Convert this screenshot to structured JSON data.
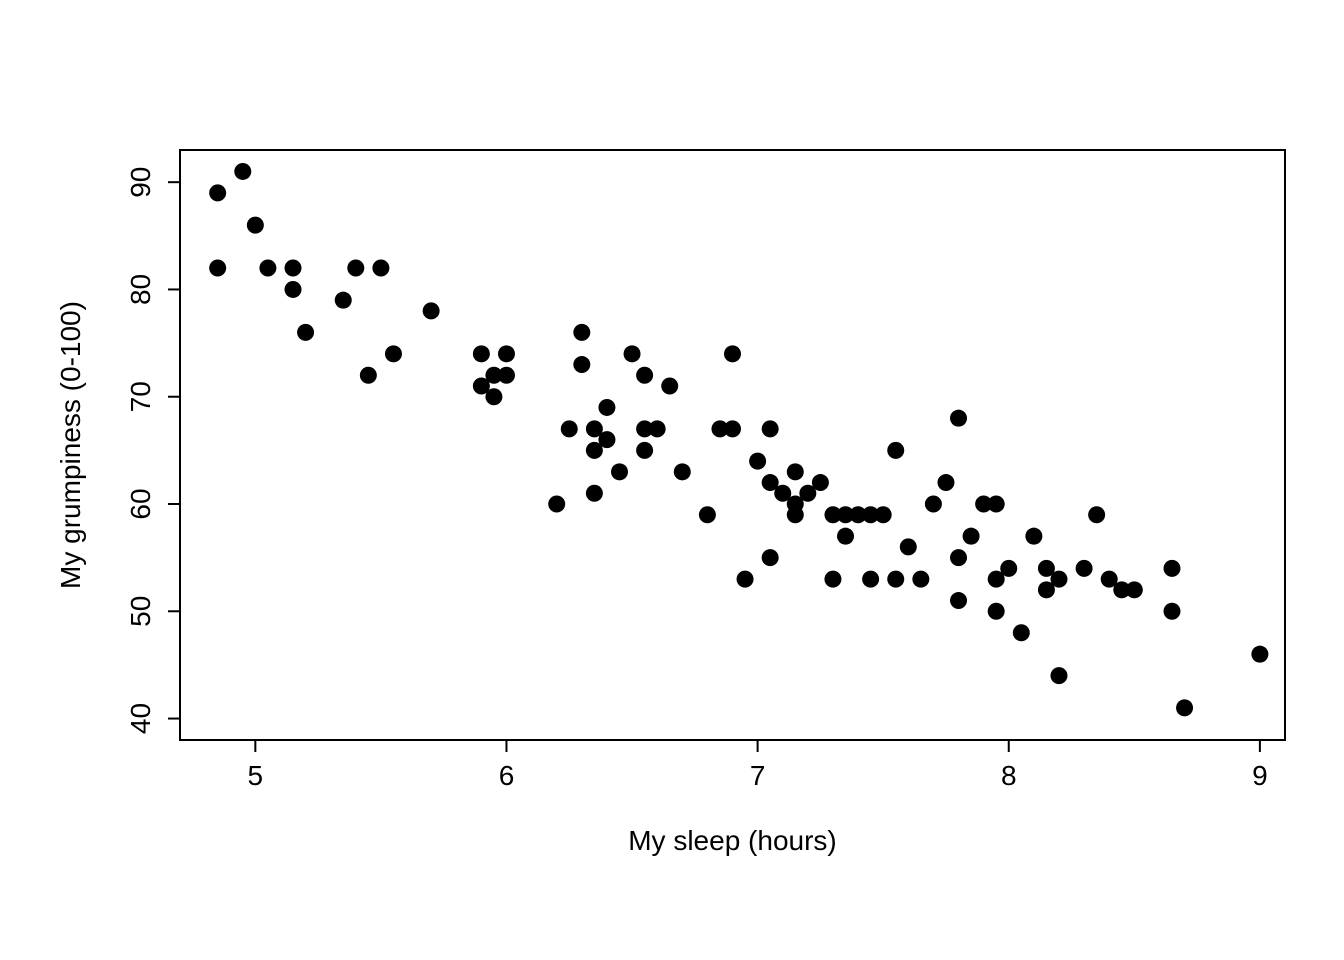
{
  "chart_data": {
    "type": "scatter",
    "title": "",
    "xlabel": "My sleep (hours)",
    "ylabel": "My grumpiness (0-100)",
    "xlim": [
      4.7,
      9.1
    ],
    "ylim": [
      38,
      93
    ],
    "xticks": [
      5,
      6,
      7,
      8,
      9
    ],
    "yticks": [
      40,
      50,
      60,
      70,
      80,
      90
    ],
    "series": [
      {
        "name": "grumpiness_vs_sleep",
        "points": [
          {
            "x": 4.85,
            "y": 89
          },
          {
            "x": 4.85,
            "y": 82
          },
          {
            "x": 4.95,
            "y": 91
          },
          {
            "x": 5.0,
            "y": 86
          },
          {
            "x": 5.05,
            "y": 82
          },
          {
            "x": 5.15,
            "y": 82
          },
          {
            "x": 5.15,
            "y": 80
          },
          {
            "x": 5.2,
            "y": 76
          },
          {
            "x": 5.35,
            "y": 79
          },
          {
            "x": 5.4,
            "y": 82
          },
          {
            "x": 5.45,
            "y": 72
          },
          {
            "x": 5.5,
            "y": 82
          },
          {
            "x": 5.55,
            "y": 74
          },
          {
            "x": 5.7,
            "y": 78
          },
          {
            "x": 5.9,
            "y": 71
          },
          {
            "x": 5.9,
            "y": 74
          },
          {
            "x": 5.95,
            "y": 70
          },
          {
            "x": 5.95,
            "y": 72
          },
          {
            "x": 6.0,
            "y": 74
          },
          {
            "x": 6.0,
            "y": 72
          },
          {
            "x": 6.2,
            "y": 60
          },
          {
            "x": 6.25,
            "y": 67
          },
          {
            "x": 6.3,
            "y": 73
          },
          {
            "x": 6.3,
            "y": 76
          },
          {
            "x": 6.35,
            "y": 65
          },
          {
            "x": 6.35,
            "y": 67
          },
          {
            "x": 6.35,
            "y": 61
          },
          {
            "x": 6.4,
            "y": 69
          },
          {
            "x": 6.4,
            "y": 66
          },
          {
            "x": 6.45,
            "y": 63
          },
          {
            "x": 6.5,
            "y": 74
          },
          {
            "x": 6.55,
            "y": 67
          },
          {
            "x": 6.55,
            "y": 72
          },
          {
            "x": 6.55,
            "y": 65
          },
          {
            "x": 6.6,
            "y": 67
          },
          {
            "x": 6.65,
            "y": 71
          },
          {
            "x": 6.7,
            "y": 63
          },
          {
            "x": 6.8,
            "y": 59
          },
          {
            "x": 6.85,
            "y": 67
          },
          {
            "x": 6.9,
            "y": 74
          },
          {
            "x": 6.9,
            "y": 67
          },
          {
            "x": 6.95,
            "y": 53
          },
          {
            "x": 7.0,
            "y": 64
          },
          {
            "x": 7.05,
            "y": 55
          },
          {
            "x": 7.05,
            "y": 67
          },
          {
            "x": 7.05,
            "y": 62
          },
          {
            "x": 7.1,
            "y": 61
          },
          {
            "x": 7.15,
            "y": 63
          },
          {
            "x": 7.15,
            "y": 60
          },
          {
            "x": 7.15,
            "y": 59
          },
          {
            "x": 7.2,
            "y": 61
          },
          {
            "x": 7.25,
            "y": 62
          },
          {
            "x": 7.3,
            "y": 59
          },
          {
            "x": 7.3,
            "y": 53
          },
          {
            "x": 7.35,
            "y": 57
          },
          {
            "x": 7.35,
            "y": 59
          },
          {
            "x": 7.4,
            "y": 59
          },
          {
            "x": 7.45,
            "y": 59
          },
          {
            "x": 7.45,
            "y": 53
          },
          {
            "x": 7.5,
            "y": 59
          },
          {
            "x": 7.55,
            "y": 65
          },
          {
            "x": 7.55,
            "y": 53
          },
          {
            "x": 7.6,
            "y": 56
          },
          {
            "x": 7.65,
            "y": 53
          },
          {
            "x": 7.7,
            "y": 60
          },
          {
            "x": 7.75,
            "y": 62
          },
          {
            "x": 7.8,
            "y": 68
          },
          {
            "x": 7.8,
            "y": 55
          },
          {
            "x": 7.8,
            "y": 51
          },
          {
            "x": 7.85,
            "y": 57
          },
          {
            "x": 7.9,
            "y": 60
          },
          {
            "x": 7.95,
            "y": 60
          },
          {
            "x": 7.95,
            "y": 53
          },
          {
            "x": 7.95,
            "y": 50
          },
          {
            "x": 8.0,
            "y": 54
          },
          {
            "x": 8.05,
            "y": 48
          },
          {
            "x": 8.1,
            "y": 57
          },
          {
            "x": 8.15,
            "y": 54
          },
          {
            "x": 8.15,
            "y": 52
          },
          {
            "x": 8.2,
            "y": 53
          },
          {
            "x": 8.2,
            "y": 44
          },
          {
            "x": 8.3,
            "y": 54
          },
          {
            "x": 8.35,
            "y": 59
          },
          {
            "x": 8.4,
            "y": 53
          },
          {
            "x": 8.45,
            "y": 52
          },
          {
            "x": 8.5,
            "y": 52
          },
          {
            "x": 8.65,
            "y": 50
          },
          {
            "x": 8.65,
            "y": 54
          },
          {
            "x": 8.7,
            "y": 41
          },
          {
            "x": 9.0,
            "y": 46
          }
        ]
      }
    ]
  }
}
